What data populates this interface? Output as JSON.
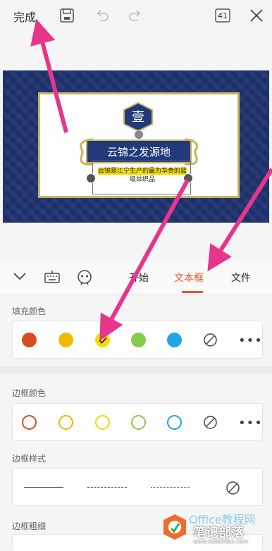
{
  "topbar": {
    "done_label": "完成",
    "page_count": "41"
  },
  "slide": {
    "badge_char": "壹",
    "title": "云锦之发源地",
    "body_line1": "云锦是江宁生产的最为华贵的蓝",
    "body_line2": "级丝织品"
  },
  "toolbar": {
    "tabs": [
      {
        "label": "开始"
      },
      {
        "label": "文本框"
      },
      {
        "label": "文件"
      }
    ]
  },
  "fill": {
    "label": "填充颜色",
    "colors": [
      "#d84c1c",
      "#f5b800",
      "#f5dd00",
      "#86cc4a",
      "#1fa6e8"
    ],
    "selected_index": 2
  },
  "border_color": {
    "label": "边框颜色",
    "colors": [
      "#c1521e",
      "#f4b400",
      "#efd800",
      "#86cc4a",
      "#1fa3d8"
    ]
  },
  "border_style": {
    "label": "边框样式"
  },
  "border_width": {
    "label": "边框粗细"
  },
  "watermark": {
    "brand": "笔记部落",
    "site": "www.notetribe.com",
    "office_text": "Office教程网"
  }
}
